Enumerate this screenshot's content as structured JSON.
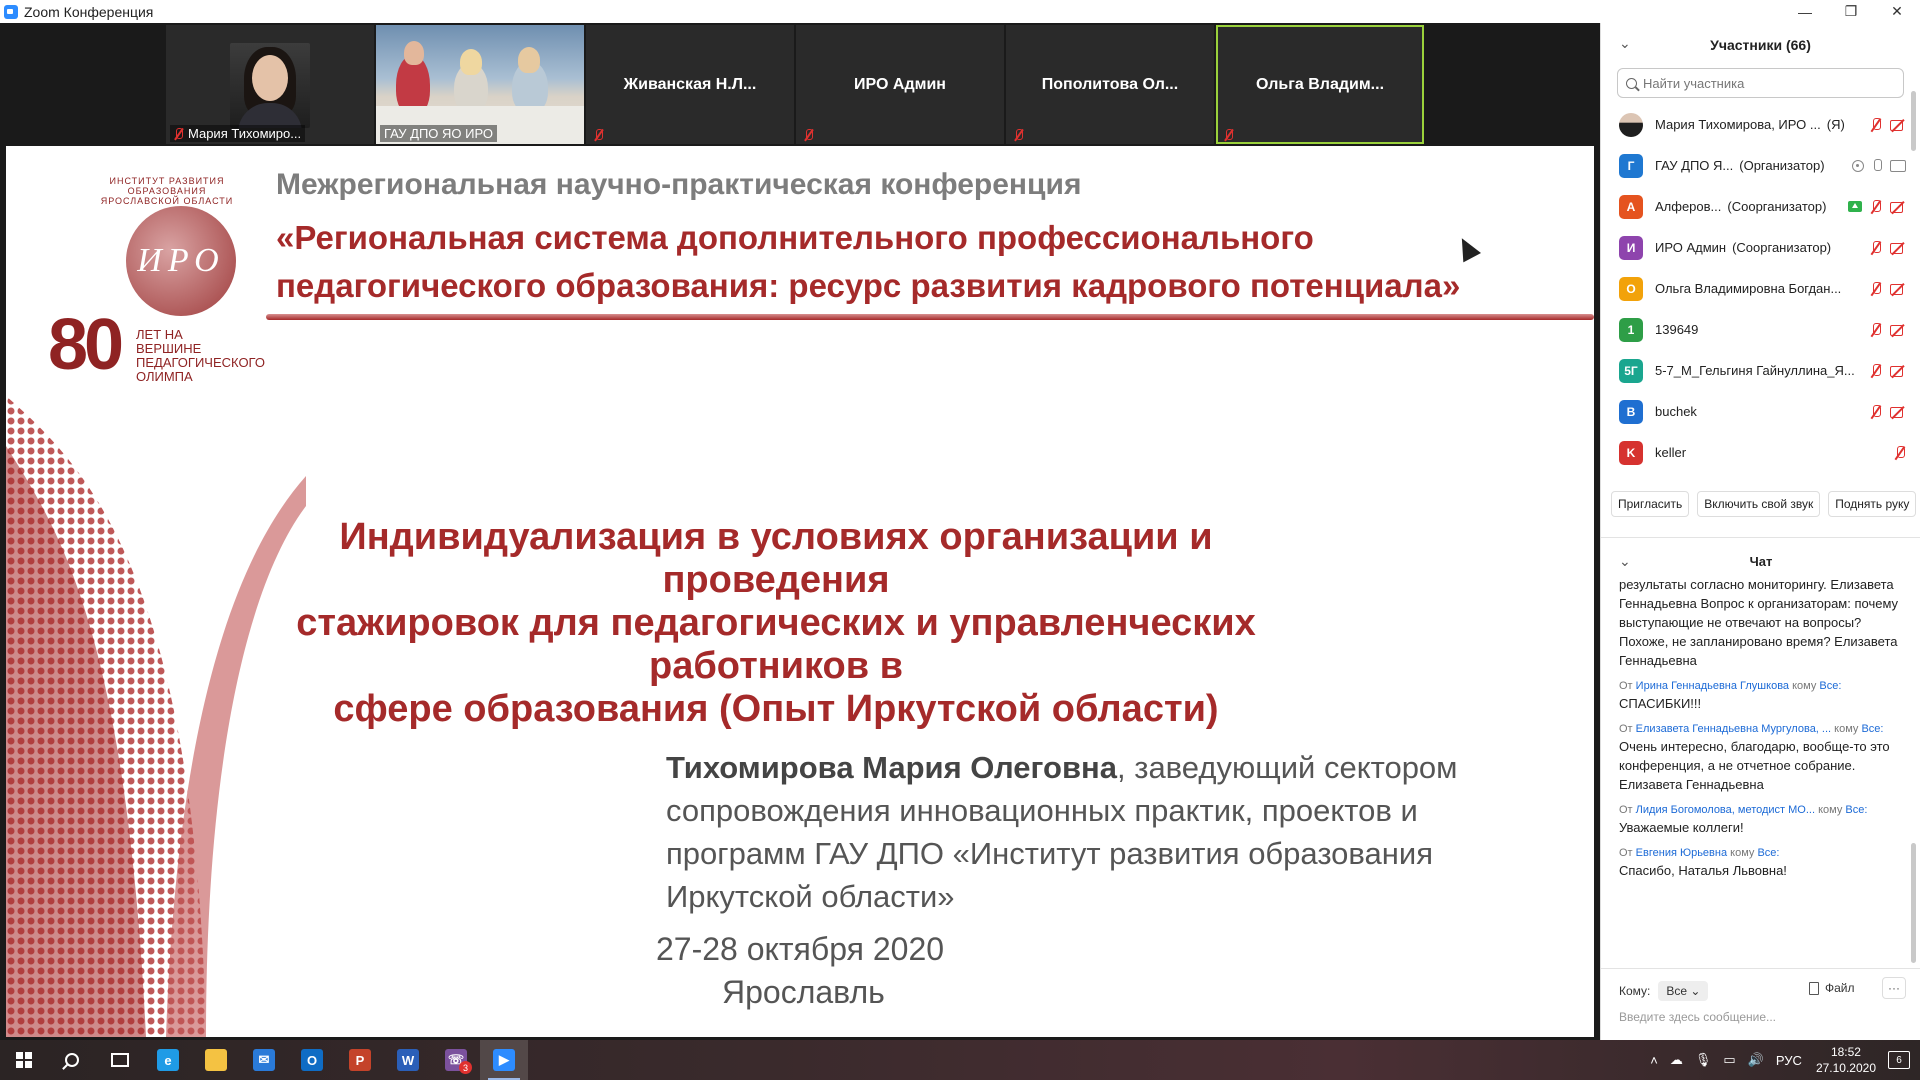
{
  "window": {
    "title": "Zoom Конференция",
    "controls": [
      "—",
      "❐",
      "✕"
    ]
  },
  "video_strip": {
    "tiles": [
      {
        "name": "Мария Тихомиро...",
        "kind": "photo",
        "muted": true
      },
      {
        "name": "ГАУ ДПО ЯО ИРО",
        "kind": "video",
        "muted": false
      },
      {
        "name": "Живанская  Н.Л...",
        "kind": "name",
        "muted": true
      },
      {
        "name": "ИРО Админ",
        "kind": "name",
        "muted": true
      },
      {
        "name": "Пополитова  Ол...",
        "kind": "name",
        "muted": true
      },
      {
        "name": "Ольга  Владим...",
        "kind": "name",
        "muted": true,
        "active": true
      }
    ],
    "next_icon": "chevron-right-icon"
  },
  "slide": {
    "header_line1": "Межрегиональная научно-практическая конференция",
    "header_line2": "«Региональная система дополнительного профессионального",
    "header_line3": "педагогического образования: ресурс развития кадрового потенциала»",
    "logo_letters": "ИРО",
    "logo_number": "80",
    "logo_years": "ЛЕТ НА ВЕРШИНЕ ПЕДАГОГИЧЕСКОГО ОЛИМПА",
    "logo_arc": "ИНСТИТУТ РАЗВИТИЯ ОБРАЗОВАНИЯ ЯРОСЛАВСКОЙ ОБЛАСТИ",
    "topic_line1": "Индивидуализация в условиях организации и проведения",
    "topic_line2": "стажировок для педагогических и управленческих работников в",
    "topic_line3": "сфере образования (Опыт Иркутской области)",
    "author_name": "Тихомирова Мария Олеговна",
    "author_rest1": ", заведующий сектором",
    "author_line2": "сопровождения инновационных практик, проектов и",
    "author_line3": "программ ГАУ ДПО «Институт развития образования",
    "author_line4": "Иркутской области»",
    "date": "27-28 октября 2020",
    "city": "Ярославль"
  },
  "participants": {
    "title": "Участники (66)",
    "search_placeholder": "Найти участника",
    "items": [
      {
        "initial": "",
        "color": "#888888",
        "name": "Мария Тихомирова, ИРО ...",
        "role": "(Я)",
        "icons": [
          "mic-off",
          "cam-off"
        ]
      },
      {
        "initial": "Г",
        "color": "#1f78d1",
        "name": "ГАУ ДПО Я...",
        "role": "(Организатор)",
        "icons": [
          "rec",
          "mic-on",
          "cam-on"
        ]
      },
      {
        "initial": "А",
        "color": "#e5531f",
        "name": "Алферов...",
        "role": "(Соорганизатор)",
        "icons": [
          "share",
          "mic-off",
          "cam-off"
        ]
      },
      {
        "initial": "И",
        "color": "#8e44ad",
        "name": "ИРО Админ",
        "role": "(Соорганизатор)",
        "icons": [
          "mic-off",
          "cam-off"
        ]
      },
      {
        "initial": "О",
        "color": "#f2a20a",
        "name": "Ольга Владимировна Богдан...",
        "role": "",
        "icons": [
          "mic-off",
          "cam-off"
        ]
      },
      {
        "initial": "1",
        "color": "#2e9e47",
        "name": "139649",
        "role": "",
        "icons": [
          "mic-off",
          "cam-off"
        ]
      },
      {
        "initial": "5Г",
        "color": "#1aa68f",
        "name": "5-7_М_Гельгиня Гайнуллина_Я...",
        "role": "",
        "icons": [
          "mic-off",
          "cam-off"
        ]
      },
      {
        "initial": "B",
        "color": "#1f6fd1",
        "name": "buchek",
        "role": "",
        "icons": [
          "mic-off",
          "cam-off"
        ]
      },
      {
        "initial": "K",
        "color": "#d6322f",
        "name": "keller",
        "role": "",
        "icons": [
          "mic-off"
        ]
      }
    ],
    "actions": {
      "invite": "Пригласить",
      "unmute": "Включить свой звук",
      "raise_hand": "Поднять руку"
    }
  },
  "chat": {
    "title": "Чат",
    "messages": [
      {
        "from": "",
        "to": "",
        "text": "результаты согласно мониторингу. Елизавета Геннадьевна Вопрос к организаторам: почему выступающие не отвечают на вопросы? Похоже, не запланировано время? Елизавета Геннадьевна"
      },
      {
        "from": "Ирина Геннадьевна Глушкова",
        "to": "Все:",
        "text": "СПАСИБКИ!!!"
      },
      {
        "from": "Елизавета Геннадьевна Мургулова, ...",
        "to": "Все:",
        "text": "Очень интересно, благодарю, вообще-то это конференция, а не отчетное собрание. Елизавета Геннадьевна"
      },
      {
        "from": "Лидия Богомолова, методист МО...",
        "to": "Все:",
        "text": "Уважаемые коллеги!"
      },
      {
        "from": "Евгения Юрьевна",
        "to": "Все:",
        "text": "Спасибо, Наталья Львовна!"
      }
    ],
    "from_prefix": "От",
    "to_word": "кому",
    "to_label": "Кому:",
    "to_value": "Все",
    "file_label": "Файл",
    "more_label": "···",
    "input_placeholder": "Введите здесь сообщение..."
  },
  "taskbar": {
    "apps": [
      {
        "name": "start",
        "icon": "windows-icon"
      },
      {
        "name": "search",
        "icon": "search-icon"
      },
      {
        "name": "task-view",
        "icon": "task-view-icon"
      },
      {
        "name": "edge",
        "icon": "edge-icon",
        "color": "#1f9be6",
        "glyph": "e"
      },
      {
        "name": "explorer",
        "icon": "folder-icon",
        "color": "#f4c242",
        "glyph": ""
      },
      {
        "name": "mail",
        "icon": "mail-icon",
        "color": "#2a7ad8",
        "glyph": "✉"
      },
      {
        "name": "outlook",
        "icon": "outlook-icon",
        "color": "#0f6cc4",
        "glyph": "O"
      },
      {
        "name": "powerpoint",
        "icon": "powerpoint-icon",
        "color": "#c4432a",
        "glyph": "P"
      },
      {
        "name": "word",
        "icon": "word-icon",
        "color": "#2b5fb8",
        "glyph": "W"
      },
      {
        "name": "viber",
        "icon": "viber-icon",
        "color": "#7b519d",
        "glyph": "☏",
        "badge": "3"
      },
      {
        "name": "zoom",
        "icon": "zoom-icon",
        "color": "#2d8cff",
        "glyph": "▶",
        "active": true
      }
    ],
    "tray": {
      "lang": "РУС",
      "time": "18:52",
      "date": "27.10.2020",
      "notifications": "6"
    }
  }
}
